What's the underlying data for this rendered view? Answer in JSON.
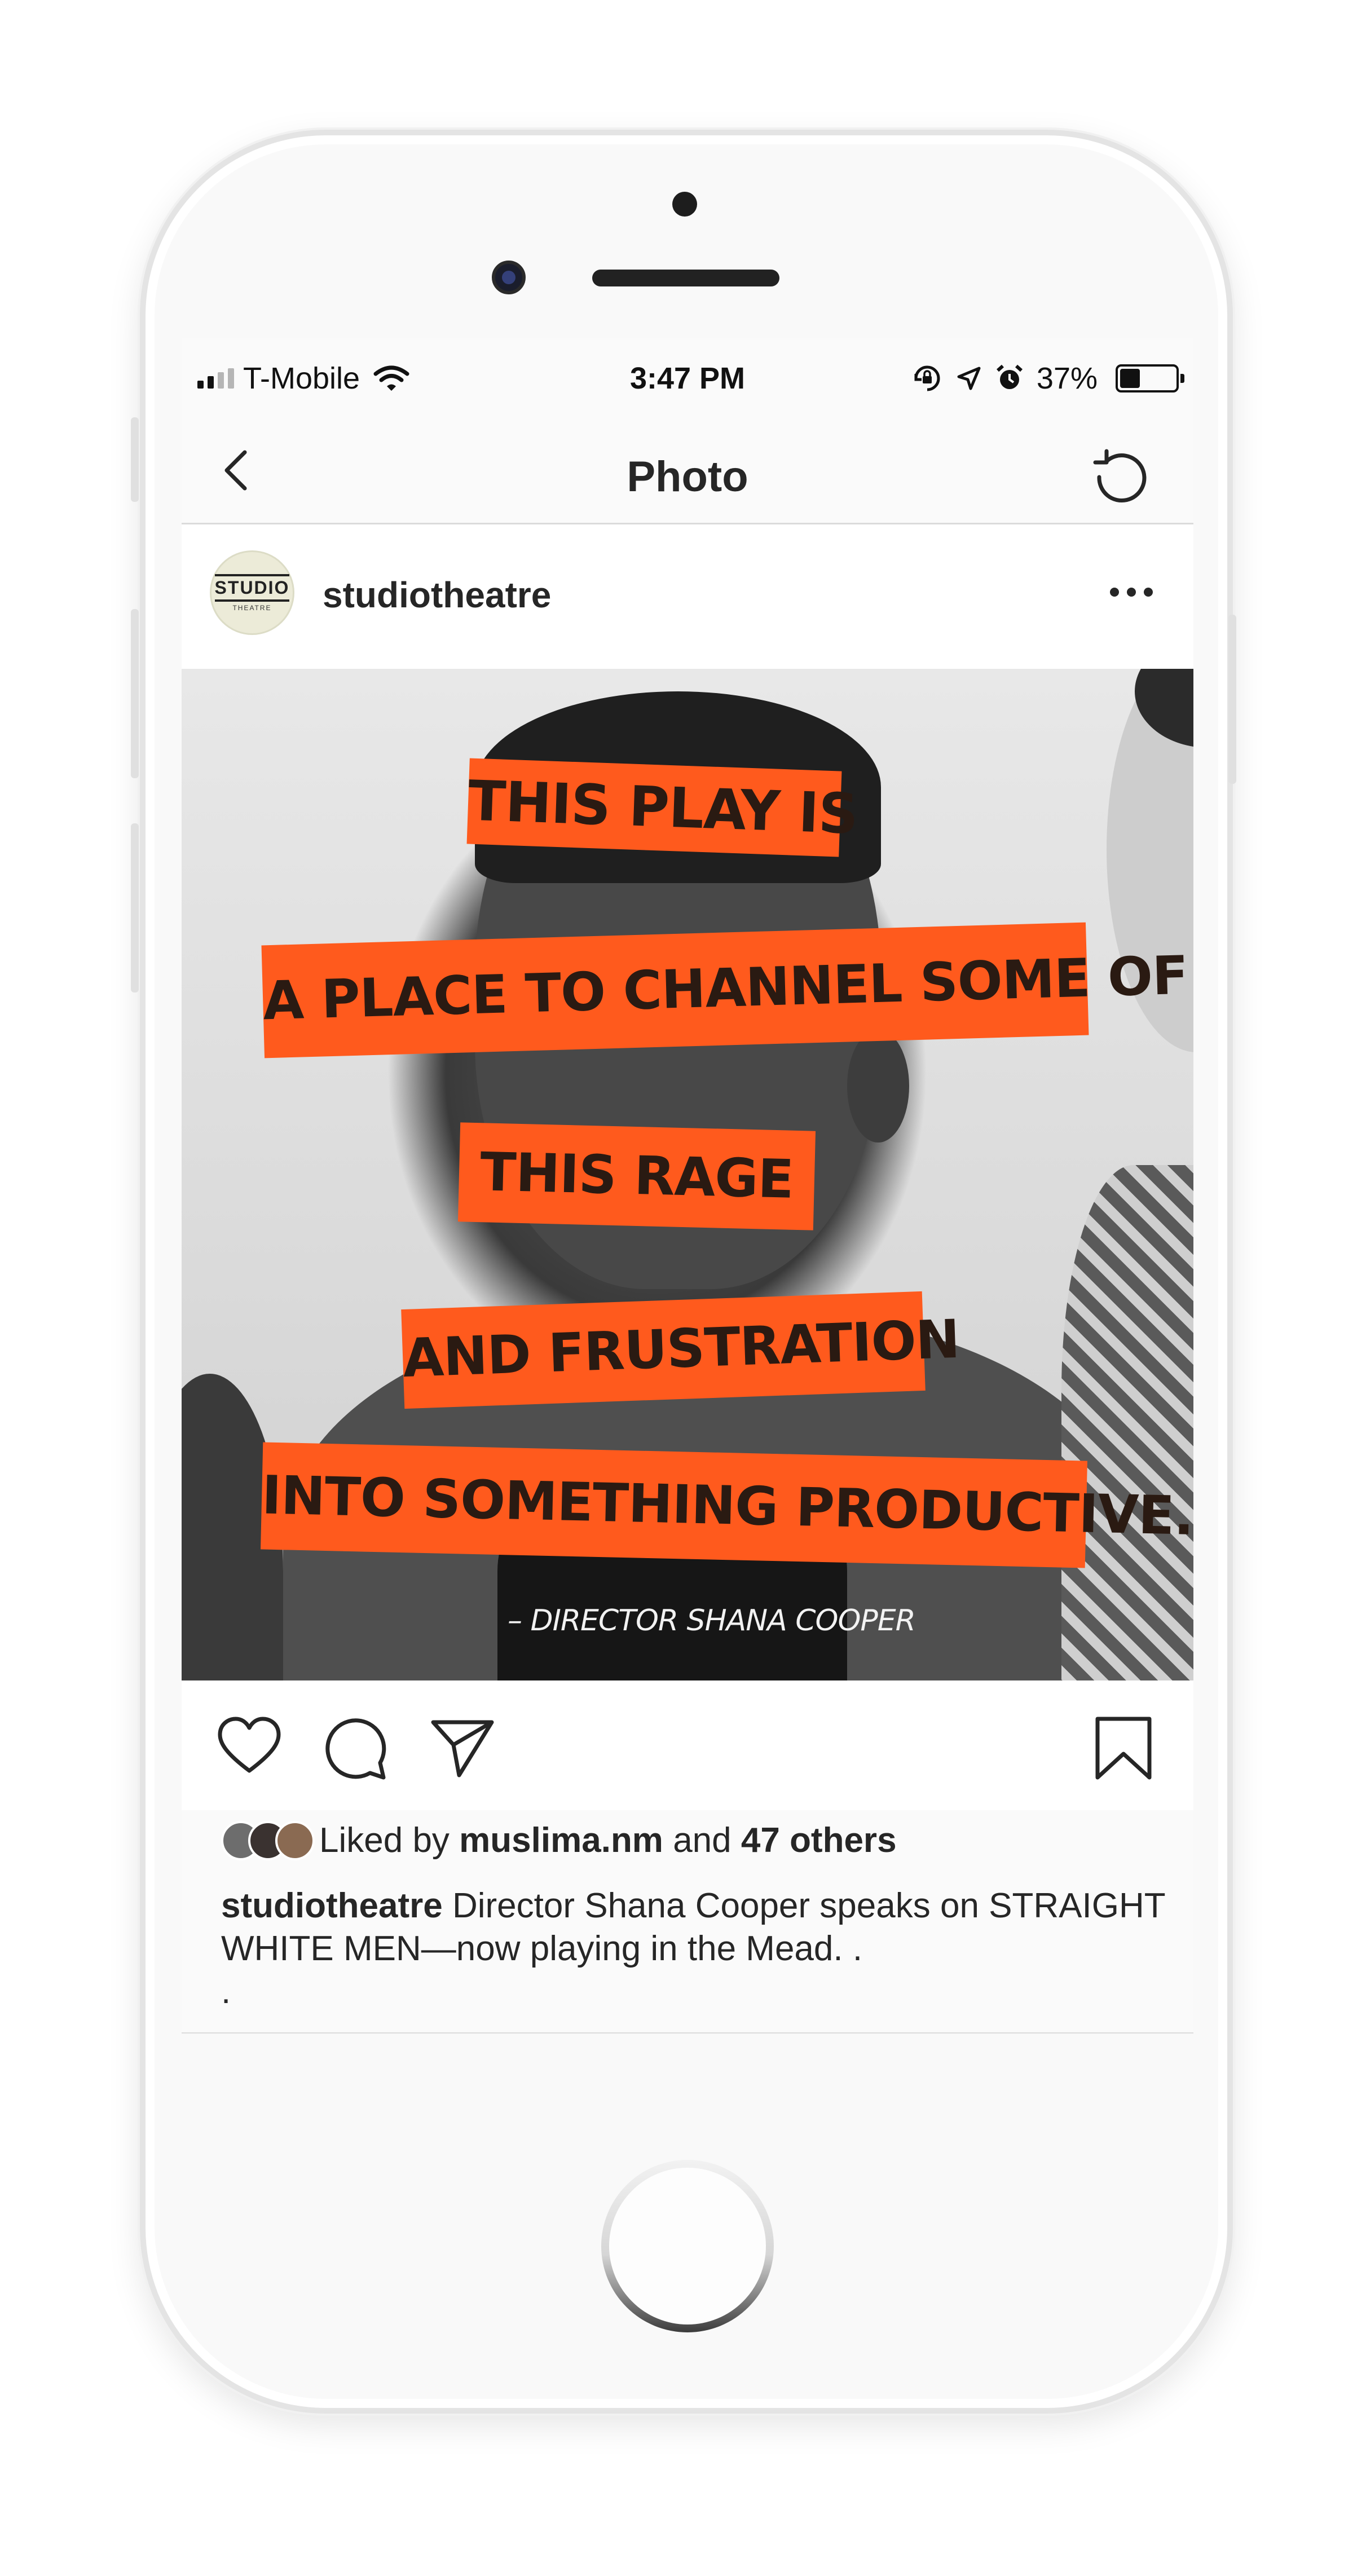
{
  "status_bar": {
    "carrier": "T-Mobile",
    "time": "3:47 PM",
    "battery_percent": "37%",
    "battery_level": 0.37
  },
  "nav": {
    "title": "Photo",
    "back_icon": "chevron-left-icon",
    "refresh_icon": "refresh-icon"
  },
  "post": {
    "username": "studiotheatre",
    "avatar_text": [
      "STUDIO",
      "THEATRE"
    ],
    "image_text": {
      "lines": [
        "THIS PLAY IS",
        "A PLACE TO CHANNEL SOME OF",
        "THIS RAGE",
        "AND FRUSTRATION",
        "INTO SOMETHING PRODUCTIVE."
      ],
      "credit": "– DIRECTOR SHANA COOPER"
    },
    "likes": {
      "prefix": "Liked by",
      "user": "muslima.nm",
      "joiner": "and",
      "others": "47 others"
    },
    "caption": {
      "username": "studiotheatre",
      "text": "Director Shana Cooper speaks on STRAIGHT WHITE MEN—now playing in the Mead. .",
      "continuation": "."
    }
  },
  "tab_bar": {
    "items": [
      "home-icon",
      "search-icon",
      "add-post-icon",
      "activity-heart-icon",
      "profile-icon"
    ],
    "active": "search-icon"
  },
  "colors": {
    "accent_orange": "#ff5a1d",
    "text": "#262626",
    "divider": "#dbdbdb"
  }
}
